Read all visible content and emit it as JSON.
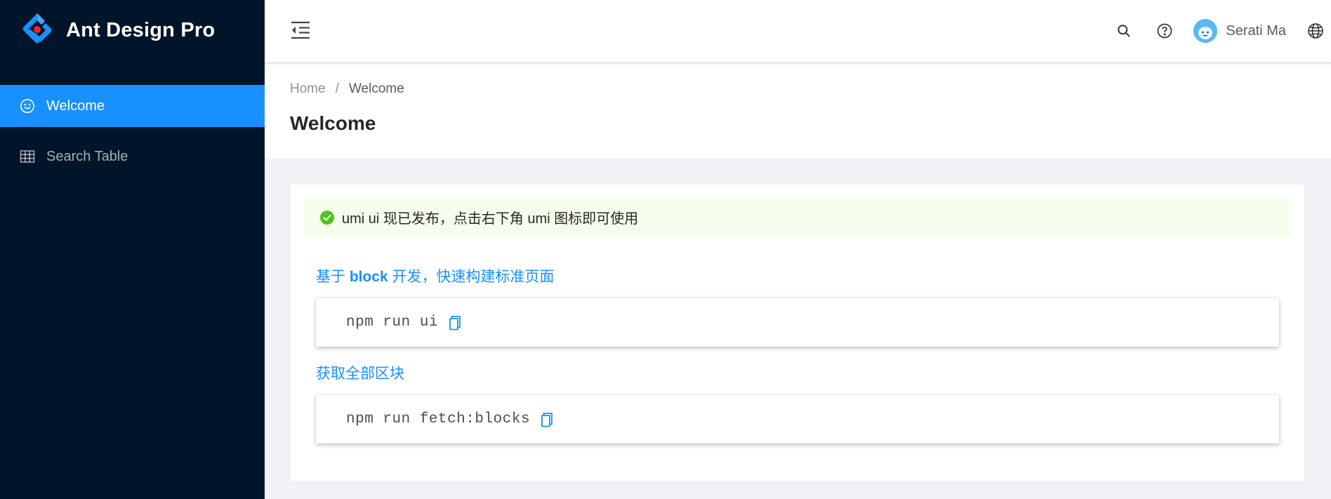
{
  "app": {
    "title": "Ant Design Pro",
    "brand_color": "#1890ff",
    "sider_bg": "#001529"
  },
  "sidebar": {
    "items": [
      {
        "label": "Welcome",
        "icon": "smile-icon",
        "active": true
      },
      {
        "label": "Search Table",
        "icon": "table-icon",
        "active": false
      }
    ]
  },
  "header": {
    "icons": [
      "menu-fold-icon",
      "search-icon",
      "question-circle-icon",
      "globe-icon"
    ],
    "user_name": "Serati Ma"
  },
  "page": {
    "breadcrumb": {
      "home": "Home",
      "separator": "/",
      "current": "Welcome"
    },
    "title": "Welcome"
  },
  "content": {
    "alert": {
      "text": "umi ui 现已发布，点击右下角 umi 图标即可使用",
      "type": "success"
    },
    "section1": {
      "prefix": "基于 ",
      "bold": "block",
      "suffix": " 开发，快速构建标准页面",
      "command": "npm run ui"
    },
    "section2": {
      "title": "获取全部区块",
      "command": "npm run fetch:blocks"
    }
  }
}
